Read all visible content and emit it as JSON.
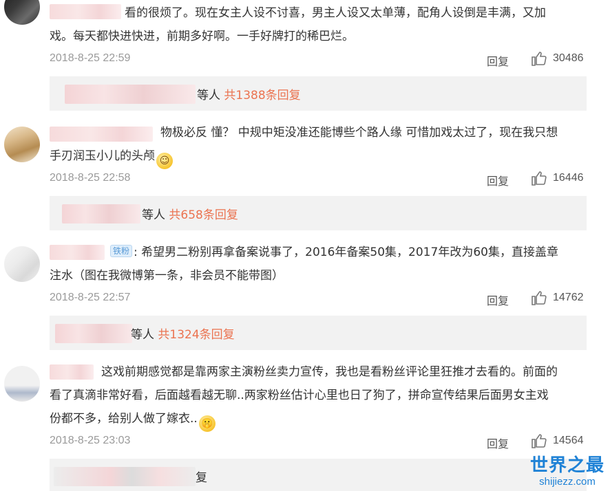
{
  "comments": [
    {
      "text_line1": "看的很烦了。现在女主人设不讨喜，男主人设又太单薄，配角人设倒是丰满，又加",
      "text_line2": "戏。每天都快进快进，前期多好啊。一手好牌打的稀巴烂。",
      "time": "2018-8-25 22:59",
      "reply_label": "回复",
      "likes": "30486",
      "replies_prefix": "等人",
      "replies_count": "共1388条回复"
    },
    {
      "text_line1": "物极必反 懂？ 中规中矩没准还能博些个路人缘 可惜加戏太过了，现在我只想",
      "text_line2": "手刃润玉小儿的头颅",
      "time": "2018-8-25 22:58",
      "reply_label": "回复",
      "likes": "16446",
      "replies_prefix": "等人",
      "replies_count": "共658条回复"
    },
    {
      "badge": "铁粉",
      "text_line1": "希望男二粉别再拿备案说事了，2016年备案50集，2017年改为60集，直接盖章",
      "text_line2": "注水（图在我微博第一条，非会员不能带图）",
      "time": "2018-8-25 22:57",
      "reply_label": "回复",
      "likes": "14762",
      "replies_prefix": "等人",
      "replies_count": "共1324条回复"
    },
    {
      "text_line1": "这戏前期感觉都是靠两家主演粉丝卖力宣传，我也是看粉丝评论里狂推才去看的。前面的",
      "text_line2": "看了真滴非常好看，后面越看越无聊..两家粉丝估计心里也日了狗了，拼命宣传结果后面男女主戏",
      "text_line3": "份都不多，给别人做了嫁衣..",
      "time": "2018-8-25 23:03",
      "reply_label": "回复",
      "likes": "14564",
      "replies_suffix": "复"
    }
  ],
  "icons": {
    "like": "thumbs-up-icon",
    "emoji_smile": "smile-emoji-icon",
    "emoji_shh": "shush-emoji-icon"
  },
  "colors": {
    "reply_count": "#eb7350",
    "watermark": "#1f82d6",
    "time": "#9a9a9a"
  },
  "watermark": {
    "title": "世界之最",
    "url": "shijiezz.com"
  }
}
